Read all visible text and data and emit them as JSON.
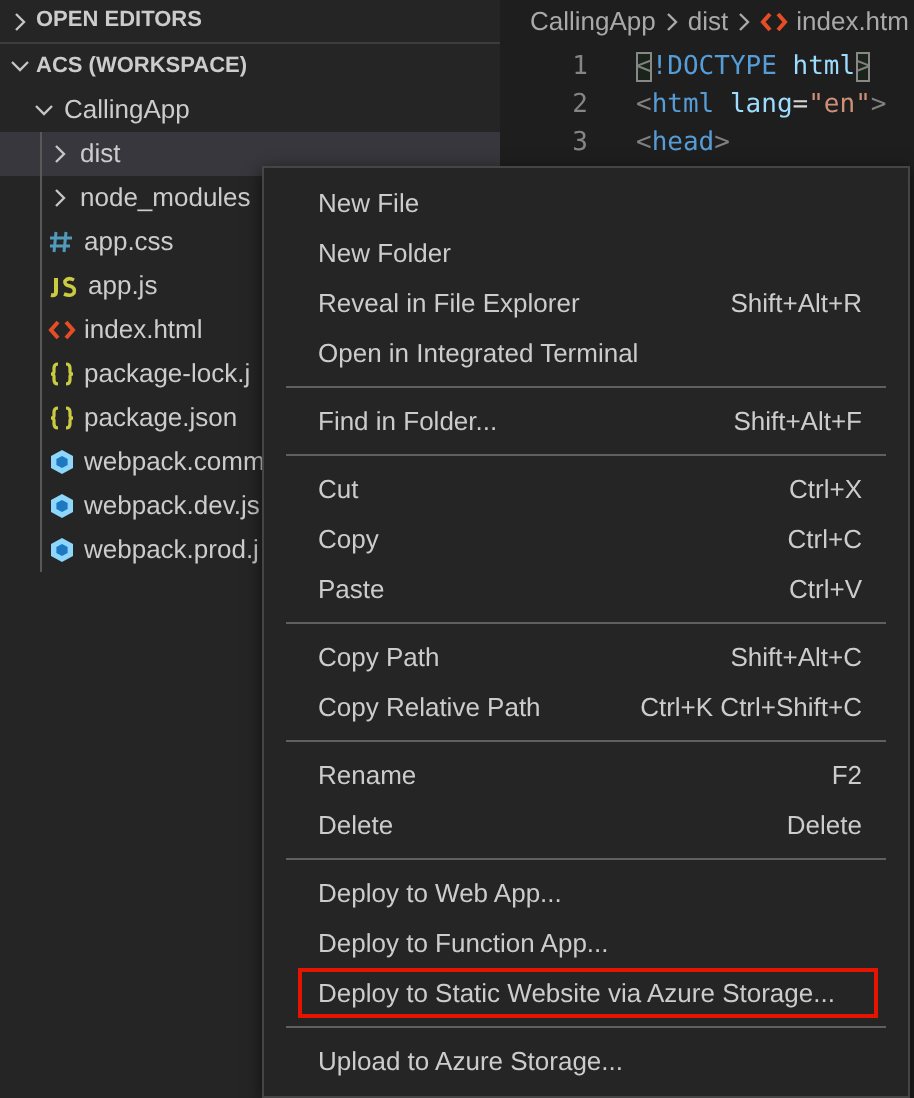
{
  "sidebar": {
    "sections": [
      {
        "title": "OPEN EDITORS",
        "expanded": false
      },
      {
        "title": "ACS (WORKSPACE)",
        "expanded": true,
        "items": [
          {
            "label": "CallingApp",
            "kind": "folder",
            "expanded": true,
            "selected": false,
            "children": [
              {
                "label": "dist",
                "kind": "folder",
                "expanded": false,
                "selected": true
              },
              {
                "label": "node_modules",
                "kind": "folder",
                "expanded": false,
                "selected": false
              },
              {
                "label": "app.css",
                "kind": "css",
                "selected": false
              },
              {
                "label": "app.js",
                "kind": "js",
                "selected": false
              },
              {
                "label": "index.html",
                "kind": "html",
                "selected": false
              },
              {
                "label": "package-lock.j",
                "kind": "json",
                "selected": false
              },
              {
                "label": "package.json",
                "kind": "json",
                "selected": false
              },
              {
                "label": "webpack.comm",
                "kind": "webpack",
                "selected": false
              },
              {
                "label": "webpack.dev.js",
                "kind": "webpack",
                "selected": false
              },
              {
                "label": "webpack.prod.j",
                "kind": "webpack",
                "selected": false
              }
            ]
          }
        ]
      }
    ]
  },
  "editor": {
    "breadcrumb": [
      "CallingApp",
      "dist",
      "index.htm"
    ],
    "lines": [
      {
        "number": "1",
        "tokens": [
          {
            "text": "<",
            "kind": "punct",
            "matched": true
          },
          {
            "text": "!DOCTYPE",
            "kind": "tag",
            "matched": false
          },
          {
            "text": " html",
            "kind": "attr",
            "matched": false
          },
          {
            "text": ">",
            "kind": "punct",
            "matched": true
          }
        ]
      },
      {
        "number": "2",
        "tokens": [
          {
            "text": "<",
            "kind": "punct",
            "matched": false
          },
          {
            "text": "html",
            "kind": "tag",
            "matched": false
          },
          {
            "text": " lang",
            "kind": "attr",
            "matched": false
          },
          {
            "text": "=",
            "kind": "plain",
            "matched": false
          },
          {
            "text": "\"en\"",
            "kind": "string",
            "matched": false
          },
          {
            "text": ">",
            "kind": "punct",
            "matched": false
          }
        ]
      },
      {
        "number": "3",
        "tokens": [
          {
            "text": "<",
            "kind": "punct",
            "matched": false
          },
          {
            "text": "head",
            "kind": "tag",
            "matched": false
          },
          {
            "text": ">",
            "kind": "punct",
            "matched": false
          }
        ]
      }
    ]
  },
  "context_menu": {
    "groups": [
      [
        {
          "label": "New File",
          "highlighted": false
        },
        {
          "label": "New Folder",
          "highlighted": false
        },
        {
          "label": "Reveal in File Explorer",
          "shortcut": "Shift+Alt+R",
          "highlighted": false
        },
        {
          "label": "Open in Integrated Terminal",
          "highlighted": false
        }
      ],
      [
        {
          "label": "Find in Folder...",
          "shortcut": "Shift+Alt+F",
          "highlighted": false
        }
      ],
      [
        {
          "label": "Cut",
          "shortcut": "Ctrl+X",
          "highlighted": false
        },
        {
          "label": "Copy",
          "shortcut": "Ctrl+C",
          "highlighted": false
        },
        {
          "label": "Paste",
          "shortcut": "Ctrl+V",
          "highlighted": false
        }
      ],
      [
        {
          "label": "Copy Path",
          "shortcut": "Shift+Alt+C",
          "highlighted": false
        },
        {
          "label": "Copy Relative Path",
          "shortcut": "Ctrl+K Ctrl+Shift+C",
          "highlighted": false
        }
      ],
      [
        {
          "label": "Rename",
          "shortcut": "F2",
          "highlighted": false
        },
        {
          "label": "Delete",
          "shortcut": "Delete",
          "highlighted": false
        }
      ],
      [
        {
          "label": "Deploy to Web App...",
          "highlighted": false
        },
        {
          "label": "Deploy to Function App...",
          "highlighted": false
        },
        {
          "label": "Deploy to Static Website via Azure Storage...",
          "highlighted": true
        }
      ],
      [
        {
          "label": "Upload to Azure Storage...",
          "highlighted": false
        }
      ]
    ]
  }
}
